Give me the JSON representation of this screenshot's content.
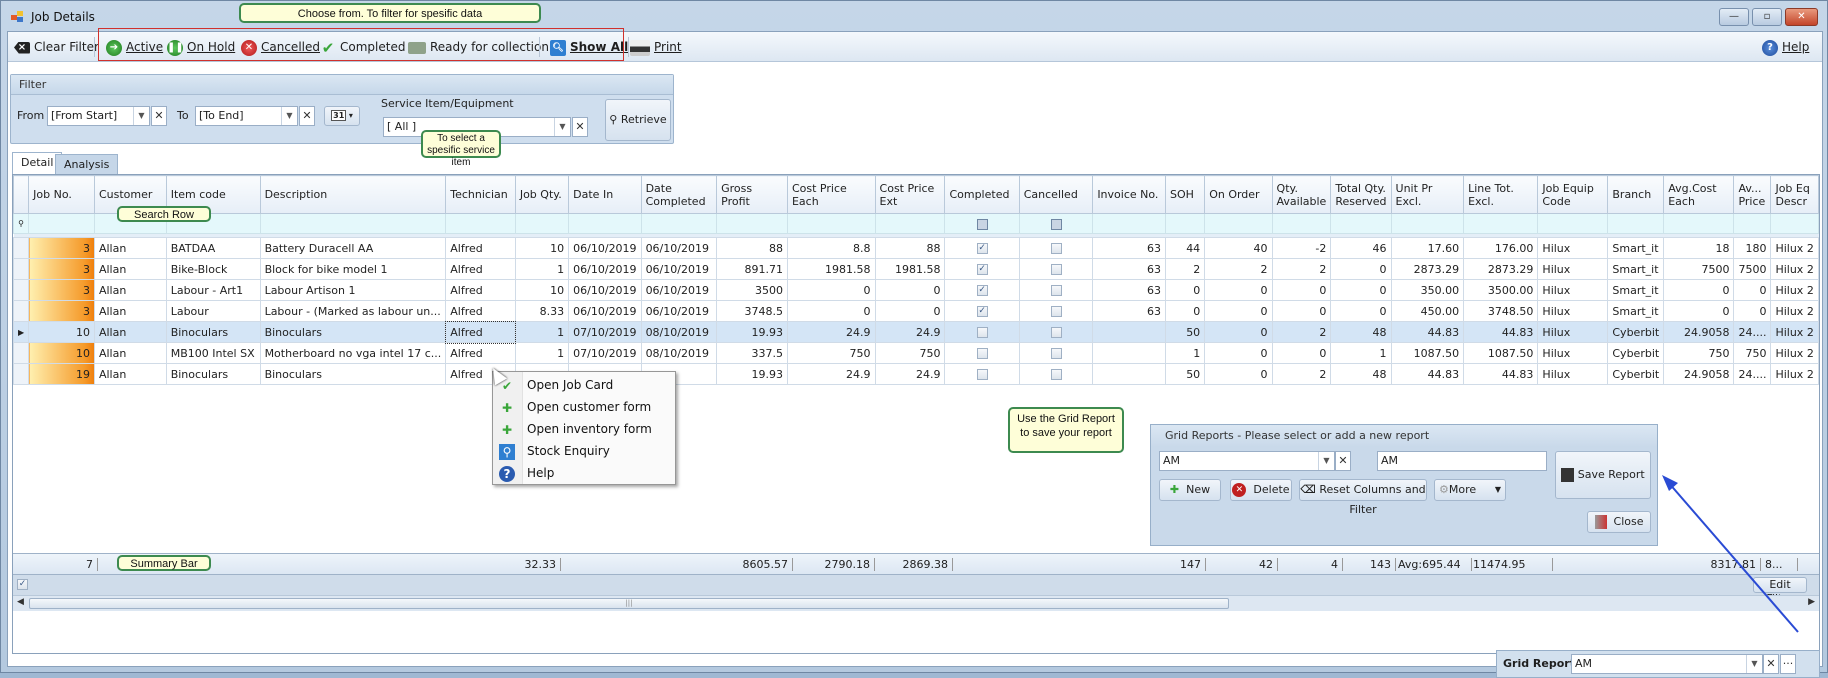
{
  "window": {
    "title": "Job Details",
    "controls": {
      "minimize": "—",
      "maximize": "▫",
      "close": "✕"
    }
  },
  "toolbar": {
    "clear_filter": "Clear Filter",
    "active": "Active",
    "on_hold": "On Hold",
    "cancelled": "Cancelled",
    "completed": "Completed",
    "ready_for_collection": "Ready for collection",
    "show_all": "Show All",
    "print": "Print",
    "help": "Help"
  },
  "callouts": {
    "toolbar": "Choose from. To filter for spesific data",
    "service_item": "To select a spesific service item",
    "search_row": "Search Row",
    "summary_bar": "Summary Bar",
    "grid_report": "Use the Grid Report to save your report"
  },
  "filter": {
    "title": "Filter",
    "from_label": "From",
    "from_value": "[From Start]",
    "to_label": "To",
    "to_value": "[To End]",
    "calendar_icon": "31",
    "service_label": "Service Item/Equipment",
    "service_value": "[ All ]",
    "retrieve": "Retrieve"
  },
  "tabs": [
    {
      "label": "Detail",
      "active": true
    },
    {
      "label": "Analysis",
      "active": false
    }
  ],
  "grid": {
    "columns": [
      "Job No.",
      "Customer",
      "Item code",
      "Description",
      "Technician",
      "Job Qty.",
      "Date In",
      "Date Completed",
      "Gross Profit",
      "Cost Price Each",
      "Cost Price Ext",
      "Completed",
      "Cancelled",
      "Invoice No.",
      "SOH",
      "On Order",
      "Qty. Available",
      "Total Qty. Reserved",
      "Unit Pr Excl.",
      "Line Tot. Excl.",
      "Job Equip Code",
      "Branch",
      "Avg.Cost Each",
      "Av... Price",
      "Job Eq Descr"
    ],
    "rows": [
      {
        "job_no": "3",
        "customer": "Allan",
        "item_code": "BATDAA",
        "description": "Battery Duracell AA",
        "technician": "Alfred",
        "job_qty": "10",
        "date_in": "06/10/2019",
        "date_completed": "06/10/2019",
        "gross_profit": "88",
        "cost_each": "8.8",
        "cost_ext": "88",
        "completed": true,
        "cancelled": false,
        "invoice_no": "63",
        "soh": "44",
        "on_order": "40",
        "qty_available": "-2",
        "total_reserved": "46",
        "unit_pr": "17.60",
        "line_tot": "176.00",
        "equip_code": "Hilux",
        "branch": "Smart_it",
        "avg_cost": "18",
        "av_price": "180",
        "equip_descr": "Hilux 2",
        "highlight": true,
        "selected": false
      },
      {
        "job_no": "3",
        "customer": "Allan",
        "item_code": "Bike-Block",
        "description": "Block for bike model 1",
        "technician": "Alfred",
        "job_qty": "1",
        "date_in": "06/10/2019",
        "date_completed": "06/10/2019",
        "gross_profit": "891.71",
        "cost_each": "1981.58",
        "cost_ext": "1981.58",
        "completed": true,
        "cancelled": false,
        "invoice_no": "63",
        "soh": "2",
        "on_order": "2",
        "qty_available": "2",
        "total_reserved": "0",
        "unit_pr": "2873.29",
        "line_tot": "2873.29",
        "equip_code": "Hilux",
        "branch": "Smart_it",
        "avg_cost": "7500",
        "av_price": "7500",
        "equip_descr": "Hilux 2",
        "highlight": true,
        "selected": false
      },
      {
        "job_no": "3",
        "customer": "Allan",
        "item_code": "Labour - Art1",
        "description": "Labour Artison 1",
        "technician": "Alfred",
        "job_qty": "10",
        "date_in": "06/10/2019",
        "date_completed": "06/10/2019",
        "gross_profit": "3500",
        "cost_each": "0",
        "cost_ext": "0",
        "completed": true,
        "cancelled": false,
        "invoice_no": "63",
        "soh": "0",
        "on_order": "0",
        "qty_available": "0",
        "total_reserved": "0",
        "unit_pr": "350.00",
        "line_tot": "3500.00",
        "equip_code": "Hilux",
        "branch": "Smart_it",
        "avg_cost": "0",
        "av_price": "0",
        "equip_descr": "Hilux 2",
        "highlight": true,
        "selected": false
      },
      {
        "job_no": "3",
        "customer": "Allan",
        "item_code": "Labour",
        "description": "Labour -  (Marked as labour un...",
        "technician": "Alfred",
        "job_qty": "8.33",
        "date_in": "06/10/2019",
        "date_completed": "06/10/2019",
        "gross_profit": "3748.5",
        "cost_each": "0",
        "cost_ext": "0",
        "completed": true,
        "cancelled": false,
        "invoice_no": "63",
        "soh": "0",
        "on_order": "0",
        "qty_available": "0",
        "total_reserved": "0",
        "unit_pr": "450.00",
        "line_tot": "3748.50",
        "equip_code": "Hilux",
        "branch": "Smart_it",
        "avg_cost": "0",
        "av_price": "0",
        "equip_descr": "Hilux 2",
        "highlight": true,
        "selected": false
      },
      {
        "job_no": "10",
        "customer": "Allan",
        "item_code": "Binoculars",
        "description": "Binoculars",
        "technician": "Alfred",
        "job_qty": "1",
        "date_in": "07/10/2019",
        "date_completed": "08/10/2019",
        "gross_profit": "19.93",
        "cost_each": "24.9",
        "cost_ext": "24.9",
        "completed": false,
        "cancelled": false,
        "invoice_no": "",
        "soh": "50",
        "on_order": "0",
        "qty_available": "2",
        "total_reserved": "48",
        "unit_pr": "44.83",
        "line_tot": "44.83",
        "equip_code": "Hilux",
        "branch": "Cyberbit",
        "avg_cost": "24.9058",
        "av_price": "24....",
        "equip_descr": "Hilux 2",
        "highlight": false,
        "selected": true
      },
      {
        "job_no": "10",
        "customer": "Allan",
        "item_code": "MB100 Intel SX",
        "description": "Motherboard no vga  intel 17 c...",
        "technician": "Alfred",
        "job_qty": "1",
        "date_in": "07/10/2019",
        "date_completed": "08/10/2019",
        "gross_profit": "337.5",
        "cost_each": "750",
        "cost_ext": "750",
        "completed": false,
        "cancelled": false,
        "invoice_no": "",
        "soh": "1",
        "on_order": "0",
        "qty_available": "0",
        "total_reserved": "1",
        "unit_pr": "1087.50",
        "line_tot": "1087.50",
        "equip_code": "Hilux",
        "branch": "Cyberbit",
        "avg_cost": "750",
        "av_price": "750",
        "equip_descr": "Hilux 2",
        "highlight": true,
        "selected": false
      },
      {
        "job_no": "19",
        "customer": "Allan",
        "item_code": "Binoculars",
        "description": "Binoculars",
        "technician": "Alfred",
        "job_qty": "",
        "date_in": "",
        "date_completed": "",
        "gross_profit": "19.93",
        "cost_each": "24.9",
        "cost_ext": "24.9",
        "completed": false,
        "cancelled": false,
        "invoice_no": "",
        "soh": "50",
        "on_order": "0",
        "qty_available": "2",
        "total_reserved": "48",
        "unit_pr": "44.83",
        "line_tot": "44.83",
        "equip_code": "Hilux",
        "branch": "Cyberbit",
        "avg_cost": "24.9058",
        "av_price": "24....",
        "equip_descr": "Hilux 2",
        "highlight": true,
        "selected": false
      }
    ],
    "summary": {
      "job_no": "7",
      "job_qty": "32.33",
      "gross_profit": "8605.57",
      "cost_each": "2790.18",
      "cost_ext": "2869.38",
      "soh": "147",
      "on_order": "42",
      "qty_available": "4",
      "total_reserved": "143",
      "unit_pr": "Avg:695.44",
      "line_tot": "11474.95",
      "avg_cost": "8317.81",
      "av_price": "8..."
    },
    "edit_filter": "Edit Filter"
  },
  "context_menu": [
    {
      "label": "Open Job Card",
      "icon": "checkmark-icon"
    },
    {
      "label": "Open customer form",
      "icon": "plus-icon"
    },
    {
      "label": "Open inventory form",
      "icon": "plus-icon"
    },
    {
      "label": "Stock Enquiry",
      "icon": "search-icon"
    },
    {
      "label": "Help",
      "icon": "help-icon"
    }
  ],
  "grid_reports": {
    "title": "Grid Reports - Please select or add a new report",
    "select_value": "AM",
    "name_value": "AM",
    "new": "New",
    "delete": "Delete",
    "reset": "Reset Columns and Filter",
    "more": "More",
    "save": "Save Report",
    "close": "Close"
  },
  "bottom": {
    "grid_report_label": "Grid Report:",
    "grid_report_value": "AM",
    "ellipsis": "···"
  },
  "colors": {
    "callout_border": "#3d8a4f",
    "callout_bg": "#fefed8",
    "highlight_box": "#d0312d",
    "selected_row": "#d4e5f6",
    "job_no_gradient_end": "#ef7e0c",
    "arrow": "#2a4bd4"
  }
}
